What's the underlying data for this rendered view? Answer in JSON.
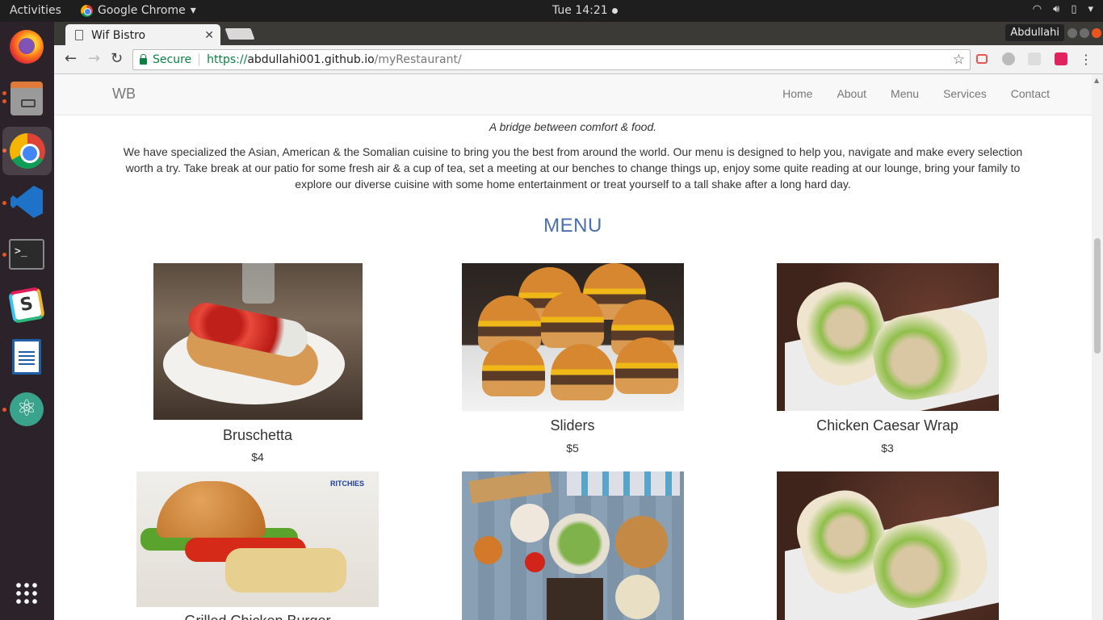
{
  "system": {
    "activities": "Activities",
    "app_name": "Google Chrome",
    "clock": "Tue 14:21",
    "dock_items": [
      "firefox-icon",
      "files-icon",
      "chrome-icon",
      "vscode-icon",
      "terminal-icon",
      "slack-icon",
      "writer-icon",
      "atom-icon",
      "show-apps-icon"
    ]
  },
  "browser": {
    "tab_title": "Wif Bistro",
    "profile": "Abdullahi",
    "secure_label": "Secure",
    "url_scheme": "https://",
    "url_host": "abdullahi001.github.io",
    "url_path": "/myRestaurant/"
  },
  "site": {
    "brand": "WB",
    "nav": [
      "Home",
      "About",
      "Menu",
      "Services",
      "Contact"
    ],
    "tagline": "A bridge between comfort & food.",
    "about": "We have specialized the Asian, American & the Somalian cuisine to bring you the best from around the world. Our menu is designed to help you, navigate and make every selection worth a try. Take break at our patio for some fresh air & a cup of tea, set a meeting at our benches to change things up, enjoy some quite reading at our lounge, bring your family to explore our diverse cuisine with some home entertainment or treat yourself to a tall shake after a long hard day.",
    "menu_heading": "MENU",
    "items": [
      {
        "name": "Bruschetta",
        "price": "$4"
      },
      {
        "name": "Sliders",
        "price": "$5"
      },
      {
        "name": "Chicken Caesar Wrap",
        "price": "$3"
      },
      {
        "name": "Grilled Chicken Burger",
        "price": ""
      },
      {
        "name": "",
        "price": ""
      },
      {
        "name": "",
        "price": ""
      }
    ],
    "burger_logo": "RITCHIES"
  },
  "colors": {
    "accent": "#4a6fb0",
    "secure_green": "#0b8043",
    "ubuntu_orange": "#e95420"
  }
}
